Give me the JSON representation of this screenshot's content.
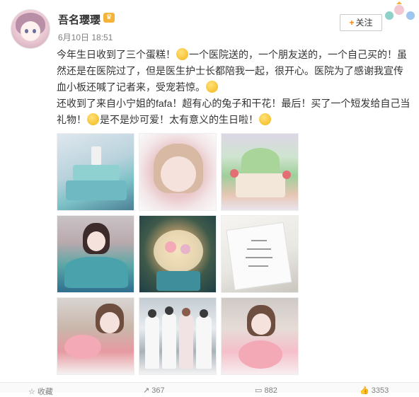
{
  "user": {
    "name": "吾名璎璎",
    "vip_icon": "vip-crown-icon",
    "timestamp": "6月10日 18:51"
  },
  "follow_button": {
    "plus": "+",
    "label": "关注"
  },
  "post": {
    "line1": "今年生日收到了三个蛋糕！",
    "line1b": "一个医院送的，一个朋友送的，一个自己买的！虽然还是在医院过了，但是医生护士长都陪我一起，很开心。医院为了感谢我宣传血小板还喊了记者来，受宠若惊。",
    "line2": "还收到了来自小宁姐的fafa！超有心的兔子和干花！最后！买了一个短发给自己当礼物！",
    "line2b": "是不是炒可爱！太有意义的生日啦！"
  },
  "emojis": [
    "emoji-laugh-cry-icon",
    "emoji-sweat-icon",
    "emoji-tongue-icon",
    "emoji-blush-icon"
  ],
  "photos": [
    {
      "name": "photo-blue-cake"
    },
    {
      "name": "photo-selfie"
    },
    {
      "name": "photo-green-cake"
    },
    {
      "name": "photo-bouquet-portrait"
    },
    {
      "name": "photo-flower-bouquet"
    },
    {
      "name": "photo-card-note"
    },
    {
      "name": "photo-pink-cake-girl"
    },
    {
      "name": "photo-medical-staff"
    },
    {
      "name": "photo-pink-cake-crown"
    }
  ],
  "actions": {
    "favorite_label": "收藏",
    "share_count": "367",
    "comment_count": "882",
    "like_count": "3353"
  },
  "colors": {
    "accent_orange": "#ff8200",
    "text": "#333333",
    "muted": "#808080",
    "vip": "#f6b33a"
  }
}
